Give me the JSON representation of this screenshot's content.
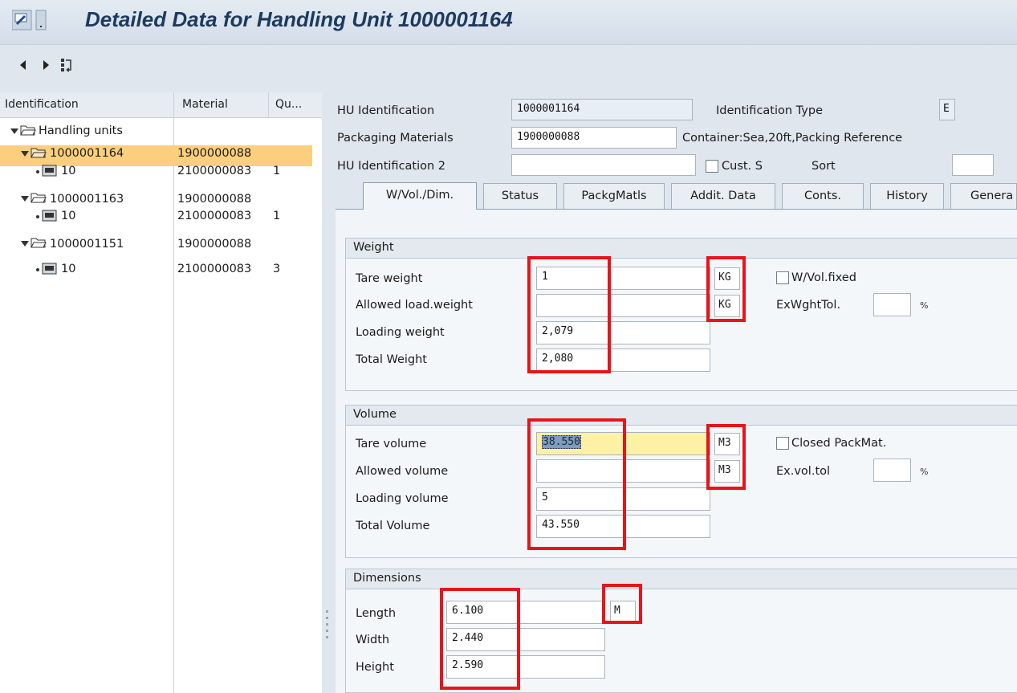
{
  "window": {
    "title": "Detailed Data for Handling Unit 1000001164",
    "icons": [
      "system-menu-icon",
      "back-arrow-icon",
      "forward-arrow-icon",
      "hierarchy-icon"
    ]
  },
  "tree": {
    "columns": [
      "Identification",
      "Material",
      "Qu..."
    ],
    "root_label": "Handling units",
    "rows": [
      {
        "id": "1000001164",
        "material": "1900000088",
        "selected": true
      },
      {
        "id": "10",
        "material": "2100000083",
        "qty": "1"
      },
      {
        "id": "1000001163",
        "material": "1900000088"
      },
      {
        "id": "10",
        "material": "2100000083",
        "qty": "1"
      },
      {
        "id": "1000001151",
        "material": "1900000088"
      },
      {
        "id": "10",
        "material": "2100000083",
        "qty": "3"
      }
    ]
  },
  "header": {
    "hu_identification_label": "HU Identification",
    "hu_identification_value": "1000001164",
    "identification_type_label": "Identification Type",
    "identification_type_value": "E",
    "packaging_materials_label": "Packaging Materials",
    "packaging_materials_value": "1900000088",
    "packaging_materials_desc": "Container:Sea,20ft,Packing Reference",
    "hu_identification2_label": "HU Identification 2",
    "hu_identification2_value": "",
    "cust_s_label": "Cust. S",
    "sort_label": "Sort",
    "sort_value": ""
  },
  "tabs": [
    "W/Vol./Dim.",
    "Status",
    "PackgMatls",
    "Addit. Data",
    "Conts.",
    "History",
    "Genera"
  ],
  "weight": {
    "title": "Weight",
    "tare_weight_label": "Tare weight",
    "tare_weight_value": "1",
    "tare_weight_unit": "KG",
    "allowed_load_label": "Allowed load.weight",
    "allowed_load_value": "",
    "allowed_load_unit": "KG",
    "loading_weight_label": "Loading weight",
    "loading_weight_value": "2,079",
    "total_weight_label": "Total Weight",
    "total_weight_value": "2,080",
    "wvol_fixed_label": "W/Vol.fixed",
    "exwght_tol_label": "ExWghtTol.",
    "exwght_tol_value": "",
    "pct_sign": "%"
  },
  "volume": {
    "title": "Volume",
    "tare_volume_label": "Tare volume",
    "tare_volume_value": "38.550",
    "tare_volume_unit": "M3",
    "allowed_volume_label": "Allowed volume",
    "allowed_volume_value": "",
    "allowed_volume_unit": "M3",
    "loading_volume_label": "Loading volume",
    "loading_volume_value": "5",
    "total_volume_label": "Total Volume",
    "total_volume_value": "43.550",
    "closed_packmat_label": "Closed PackMat.",
    "exvol_tol_label": "Ex.vol.tol",
    "exvol_tol_value": "",
    "pct_sign": "%"
  },
  "dimensions": {
    "title": "Dimensions",
    "length_label": "Length",
    "length_value": "6.100",
    "length_unit": "M",
    "width_label": "Width",
    "width_value": "2.440",
    "height_label": "Height",
    "height_value": "2.590"
  },
  "colors": {
    "highlight_box": "#e8141a",
    "selected_row": "#fbcf7e",
    "title_text": "#1d3a5e"
  }
}
